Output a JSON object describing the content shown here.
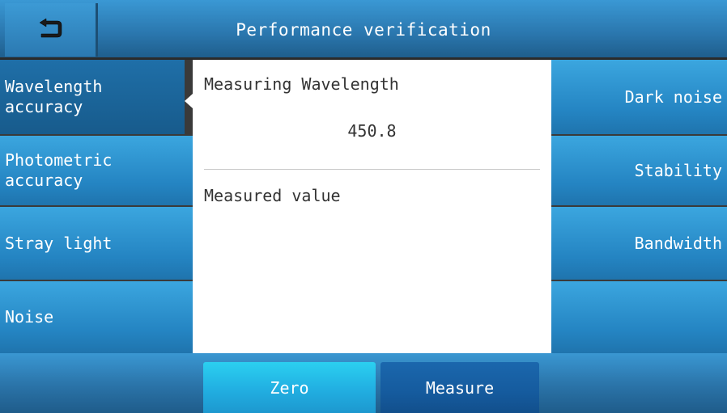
{
  "header": {
    "title": "Performance verification",
    "back_icon": "return-arrow-icon"
  },
  "left_menu": {
    "items": [
      {
        "line1": "Wavelength",
        "line2": "accuracy",
        "active": true
      },
      {
        "line1": "Photometric",
        "line2": "accuracy",
        "active": false
      },
      {
        "line1": "Stray light",
        "line2": "",
        "active": false
      },
      {
        "line1": "Noise",
        "line2": "",
        "active": false
      }
    ]
  },
  "right_menu": {
    "items": [
      {
        "label": "Dark noise"
      },
      {
        "label": "Stability"
      },
      {
        "label": "Bandwidth"
      },
      {
        "label": ""
      }
    ]
  },
  "main": {
    "measuring_wavelength_label": "Measuring Wavelength",
    "measuring_wavelength_value": "450.8",
    "measured_value_label": "Measured value",
    "measured_value": ""
  },
  "footer": {
    "zero_label": "Zero",
    "measure_label": "Measure"
  },
  "colors": {
    "primary_blue": "#2a84c2",
    "active_blue": "#1b67ad",
    "zero_cyan": "#22b1e3",
    "panel_bg": "#ffffff"
  }
}
